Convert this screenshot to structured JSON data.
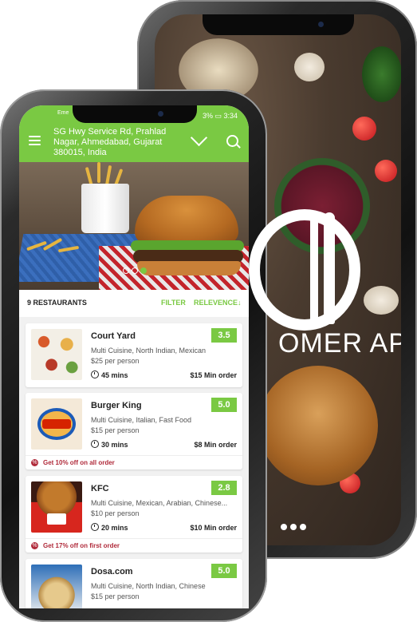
{
  "back_phone": {
    "title_text": "OMER APP",
    "colors": {
      "title": "#ffffff"
    }
  },
  "front_phone": {
    "status": {
      "left": "Eme",
      "right": "3% ▭ 3:34"
    },
    "header": {
      "address": "SG Hwy Service Rd, Prahlad Nagar, Ahmedabad, Gujarat 380015, India",
      "menu_icon": "hamburger-icon",
      "dropdown_icon": "chevron-down-icon",
      "search_icon": "search-icon",
      "color": "#7ac943"
    },
    "banner": {
      "slides": 3,
      "active_slide": 3
    },
    "list_bar": {
      "count_label": "9 RESTAURANTS",
      "filter_label": "FILTER",
      "sort_label": "RELEVENCE↓"
    },
    "restaurants": [
      {
        "name": "Court Yard",
        "rating": "3.5",
        "cuisine": "Multi Cuisine, North Indian, Mexican",
        "price": "$25 per person",
        "time": "45 mins",
        "min_order": "$15 Min order",
        "offer": ""
      },
      {
        "name": "Burger King",
        "rating": "5.0",
        "cuisine": "Multi Cuisine, Italian, Fast Food",
        "price": "$15 per person",
        "time": "30 mins",
        "min_order": "$8 Min order",
        "offer": "Get 10% off on all order"
      },
      {
        "name": "KFC",
        "rating": "2.8",
        "cuisine": "Multi Cuisine, Mexican, Arabian, Chinese...",
        "price": "$10 per person",
        "time": "20 mins",
        "min_order": "$10 Min order",
        "offer": "Get 17% off on first order"
      },
      {
        "name": "Dosa.com",
        "rating": "5.0",
        "cuisine": "Multi Cuisine, North Indian, Chinese",
        "price": "$15 per person",
        "time": "",
        "min_order": "",
        "offer": ""
      }
    ]
  }
}
